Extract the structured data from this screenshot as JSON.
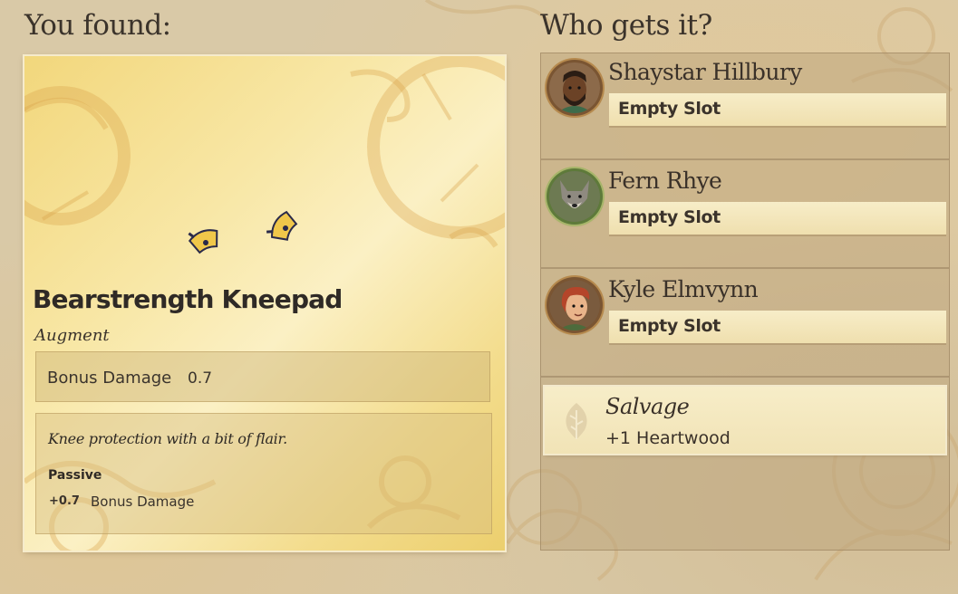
{
  "headings": {
    "found": "You found:",
    "who": "Who gets it?"
  },
  "item": {
    "name": "Bearstrength Kneepad",
    "type": "Augment",
    "stat_label": "Bonus Damage",
    "stat_value": "0.7",
    "description": "Knee protection with a bit of flair.",
    "passive_label": "Passive",
    "passive_value": "+0.7",
    "passive_stat": "Bonus Damage",
    "icon": "kneepad-icon"
  },
  "party": [
    {
      "name": "Shaystar Hillbury",
      "slot": "Empty Slot",
      "avatar": "avatar-bearded-man"
    },
    {
      "name": "Fern Rhye",
      "slot": "Empty Slot",
      "avatar": "avatar-wolf"
    },
    {
      "name": "Kyle Elmvynn",
      "slot": "Empty Slot",
      "avatar": "avatar-red-haired-youth"
    }
  ],
  "salvage": {
    "title": "Salvage",
    "reward": "+1 Heartwood",
    "icon": "leaf-icon"
  },
  "colors": {
    "card_gold": "#f3dc8c",
    "slot_cream": "#f3e6bb",
    "panel_bg": "#c9b48d",
    "text_dark": "#3a3129"
  }
}
